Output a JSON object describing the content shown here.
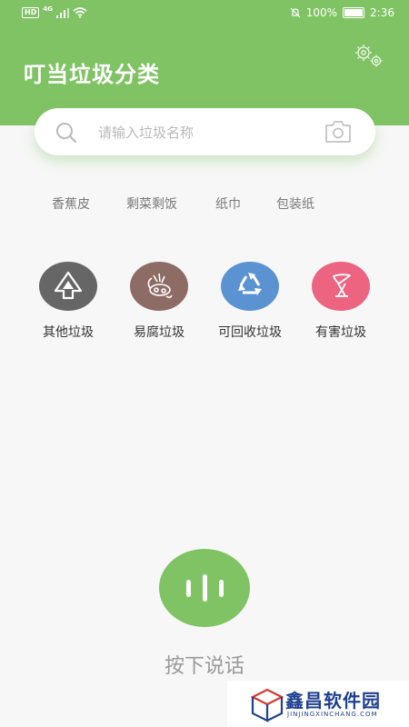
{
  "status_bar": {
    "left_badge": "HD",
    "network": "4G",
    "battery": "100%",
    "time": "2:36"
  },
  "header": {
    "title": "叮当垃圾分类",
    "settings_icon": "gears-icon"
  },
  "search": {
    "placeholder": "请输入垃圾名称",
    "left_icon": "search-icon",
    "right_icon": "camera-icon"
  },
  "hot_searches": [
    "香蕉皮",
    "剩菜剩饭",
    "纸巾",
    "包装纸"
  ],
  "categories": [
    {
      "label": "其他垃圾",
      "color": "#666666",
      "icon": "other-waste-icon"
    },
    {
      "label": "易腐垃圾",
      "color": "#8e6c66",
      "icon": "food-waste-icon"
    },
    {
      "label": "可回收垃圾",
      "color": "#5b93d2",
      "icon": "recycle-icon"
    },
    {
      "label": "有害垃圾",
      "color": "#ec6480",
      "icon": "hazardous-waste-icon"
    }
  ],
  "voice": {
    "label": "按下说话",
    "icon": "voice-bars-icon"
  },
  "watermark": {
    "title": "鑫昌软件园",
    "subtitle": "JINJINGXINCHANG.COM"
  },
  "colors": {
    "brand_green": "#80c364",
    "background": "#f7f7f7"
  }
}
